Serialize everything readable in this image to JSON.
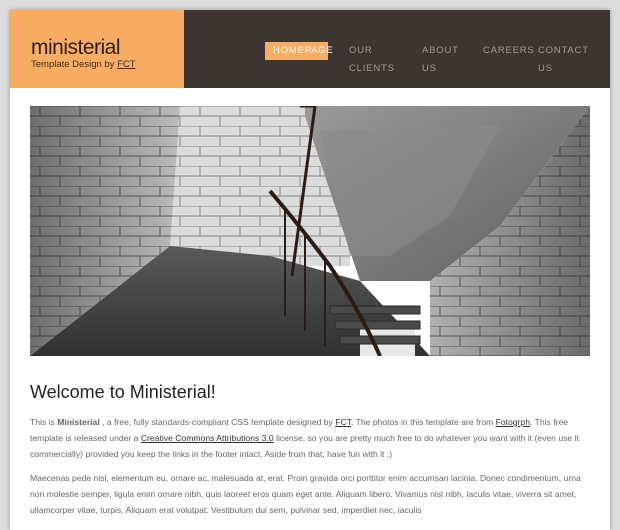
{
  "brand": {
    "logo": "ministerial",
    "tagline_prefix": "Template Design by",
    "tagline_link": "FCT"
  },
  "nav": {
    "items": [
      {
        "label": "Homepage",
        "active": true
      },
      {
        "label": "Our Clients",
        "active": false
      },
      {
        "label": "About Us",
        "active": false
      },
      {
        "label": "Careers",
        "active": false
      },
      {
        "label": "Contact Us",
        "active": false
      }
    ]
  },
  "colors": {
    "accent": "#f9ad62",
    "nav_bg": "#3c3531"
  },
  "content": {
    "title": "Welcome to Ministerial!",
    "p1": {
      "t1": "This is ",
      "name": "Ministerial",
      "t2": " , a free, fully standards-compliant CSS template designed by ",
      "link1": "FCT",
      "t3": ". The photos in this template are from ",
      "link2": "Fotogrph",
      "t4": ". This free template is released under a ",
      "link3": "Creative Commons Attributions 3.0",
      "t5": " license, so you are pretty much free to do whatever you want with it (even use it commercially) provided you keep the links in the footer intact. Aside from that, have fun with it :)"
    },
    "p2": "Maecenas pede nisl, elementum eu, ornare ac, malesuada at, erat. Proin gravida orci porttitor enim accumsan lacinia. Donec condimentum, urna non molestie semper, ligula enim ornare nibh, quis laoreet eros quam eget ante. Aliquam libero. Vivamus nisl nibh, iaculis vitae, viverra sit amet, ullamcorper vitae, turpis. Aliquam erat volutpat. Vestibulum dui sem, pulvinar sed, imperdiet nec, iaculis"
  }
}
